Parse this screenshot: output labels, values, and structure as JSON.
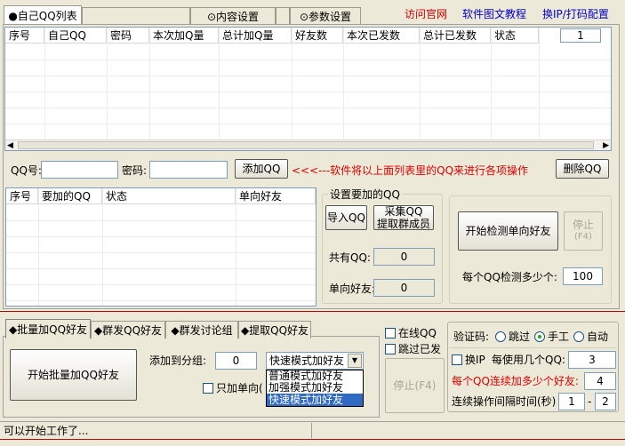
{
  "top_tabs": [
    {
      "label": "●自己QQ列表"
    },
    {
      "label": "⊙内容设置"
    },
    {
      "label": "⊙参数设置"
    }
  ],
  "top_links": {
    "visit_site": "访问官网",
    "tutorial": "软件图文教程",
    "ip_captcha": "换IP/打码配置"
  },
  "own_qq_table": {
    "columns": [
      "序号",
      "自己QQ",
      "密码",
      "本次加Q量",
      "总计加Q量",
      "好友数",
      "本次已发数",
      "总计已发数",
      "状态"
    ],
    "page_number": "1"
  },
  "qq_entry": {
    "qq_label": "QQ号:",
    "qq_value": "",
    "password_label": "密码:",
    "password_value": "",
    "add_button": "添加QQ",
    "hint": "<<<---软件将以上面列表里的QQ来进行各项操作",
    "delete_button": "删除QQ"
  },
  "target_table": {
    "columns": [
      "序号",
      "要加的QQ",
      "状态",
      "单向好友"
    ]
  },
  "target_settings": {
    "title": "设置要加的QQ",
    "import_button": "导入QQ",
    "collect_button_line1": "采集QQ",
    "collect_button_line2": "提取群成员",
    "total_label": "共有QQ:",
    "total_value": "0",
    "oneway_label": "单向好友:",
    "oneway_value": "0"
  },
  "oneway_check": {
    "start_button": "开始检测单向好友",
    "stop_button_line1": "停止",
    "stop_button_line2": "(F4)",
    "per_qq_label": "每个QQ检测多少个:",
    "per_qq_value": "100"
  },
  "bottom_tabs": [
    {
      "label": "◆批量加QQ好友"
    },
    {
      "label": "◆群发QQ好友"
    },
    {
      "label": "◆群发讨论组"
    },
    {
      "label": "◆提取QQ好友"
    }
  ],
  "batch_add": {
    "start_button": "开始批量加QQ好友",
    "group_label": "添加到分组:",
    "group_value": "0",
    "mode_selected": "快速模式加好友",
    "mode_options": [
      "普通模式加好友",
      "加强模式加好友",
      "快速模式加好友"
    ],
    "oneway_only_label": "只加单向("
  },
  "options": {
    "online_qq": "在线QQ",
    "skip_sent": "跳过已发",
    "stop_button": "停止(F4)"
  },
  "captcha": {
    "label": "验证码:",
    "skip": "跳过",
    "manual": "手工",
    "auto": "自动",
    "selected": "手工"
  },
  "ip_settings": {
    "change_ip_label": "换IP",
    "per_qq_label": "每使用几个QQ:",
    "per_qq_value": "3",
    "continuous_label": "每个QQ连续加多少个好友:",
    "continuous_value": "4",
    "interval_label": "连续操作间隔时间(秒)",
    "interval_min": "1",
    "interval_max": "2"
  },
  "status_bar": {
    "message": "可以开始工作了..."
  },
  "colors": {
    "window_bg": "#ece9d8",
    "link_red": "#d40000",
    "link_blue": "#0000c8",
    "hint_red": "#e00000",
    "selection_blue": "#316ac5"
  }
}
